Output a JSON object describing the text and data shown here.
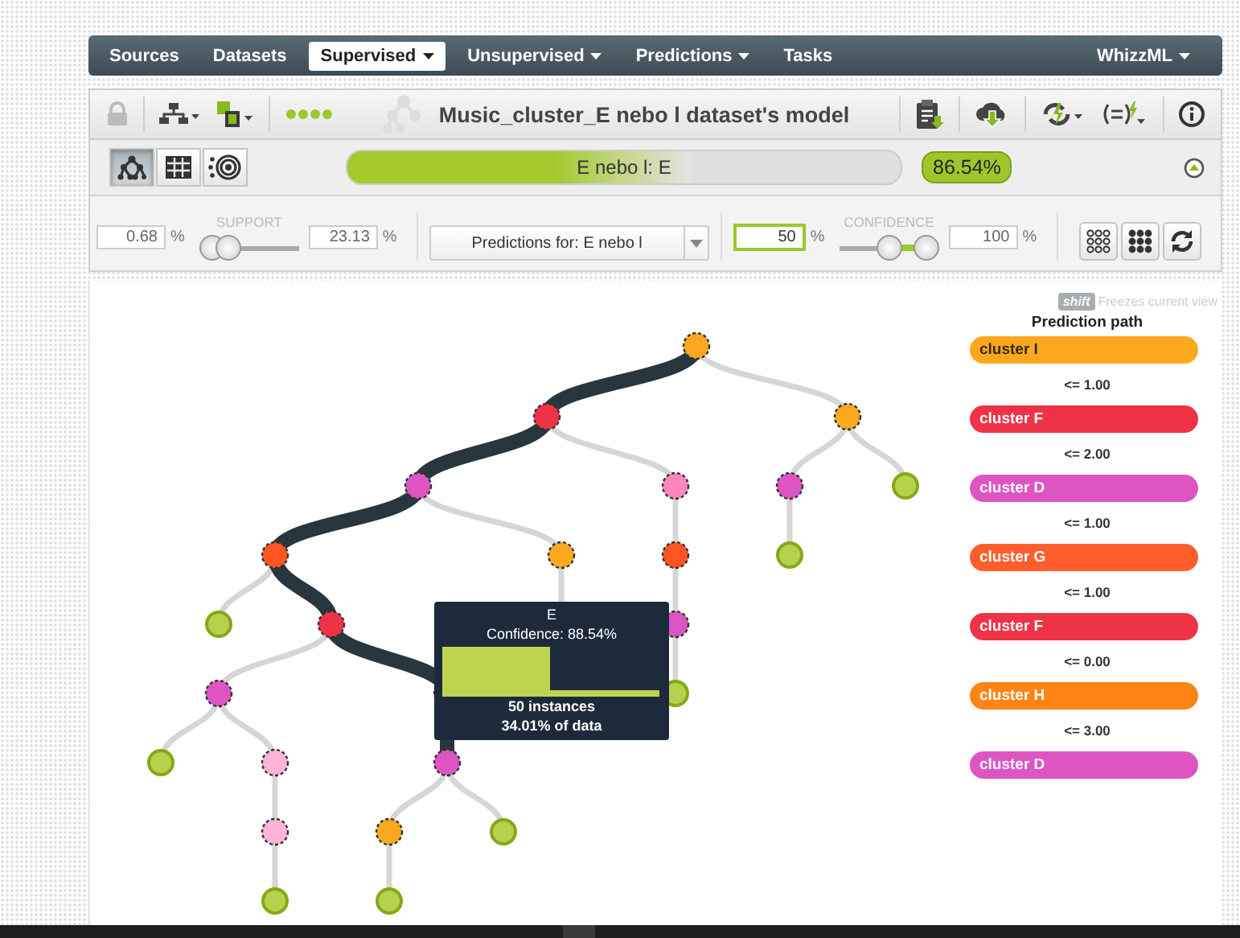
{
  "nav": {
    "items": [
      {
        "label": "Sources",
        "selected": false,
        "has_menu": false
      },
      {
        "label": "Datasets",
        "selected": false,
        "has_menu": false
      },
      {
        "label": "Supervised",
        "selected": true,
        "has_menu": true
      },
      {
        "label": "Unsupervised",
        "selected": false,
        "has_menu": true
      },
      {
        "label": "Predictions",
        "selected": false,
        "has_menu": true
      },
      {
        "label": "Tasks",
        "selected": false,
        "has_menu": false
      }
    ],
    "right": {
      "label": "WhizzML",
      "has_menu": true
    }
  },
  "toolbar": {
    "title": "Music_cluster_E nebo l dataset's model"
  },
  "views": [
    {
      "kind": "tree",
      "selected": true
    },
    {
      "kind": "grid",
      "selected": false
    },
    {
      "kind": "radial",
      "selected": false
    }
  ],
  "prediction": {
    "label": "E nebo l: E",
    "level": 0.62,
    "confidence": "86.54%"
  },
  "support": {
    "label": "SUPPORT",
    "fields": [
      {
        "value": "0.68",
        "unit": "%",
        "focused": false
      },
      {
        "value": "23.13",
        "unit": "%",
        "focused": false
      }
    ],
    "low": {
      "level": 0.0
    },
    "high": {
      "level": 0.22
    }
  },
  "objective": {
    "value": "Predictions for: E nebo l"
  },
  "confidence": {
    "label": "CONFIDENCE",
    "fields": [
      {
        "value": "50",
        "unit": "%",
        "focused": true
      },
      {
        "value": "100",
        "unit": "%",
        "focused": false
      }
    ],
    "low": {
      "level": 0.5
    },
    "high": {
      "level": 1
    }
  },
  "hint": {
    "key": "shift",
    "text": "Freezes current view"
  },
  "path": {
    "title": "Prediction path",
    "nodes": [
      {
        "label": "cluster I",
        "color": "#fba81f",
        "condition": "<= 1.00"
      },
      {
        "label": "cluster F",
        "color": "#ee3347",
        "condition": "<= 2.00"
      },
      {
        "label": "cluster D",
        "color": "#dd55c3",
        "condition": "<= 1.00"
      },
      {
        "label": "cluster G",
        "color": "#ff5e2c",
        "condition": "<= 1.00"
      },
      {
        "label": "cluster F",
        "color": "#ee3347",
        "condition": "<= 0.00"
      },
      {
        "label": "cluster H",
        "color": "#ff8416",
        "condition": "<= 3.00"
      },
      {
        "label": "cluster D",
        "color": "#dd55c3"
      }
    ]
  },
  "tooltip": {
    "title": "E",
    "confidence": "Confidence: 88.54%",
    "instances": "50 instances",
    "share": "34.01% of data"
  }
}
